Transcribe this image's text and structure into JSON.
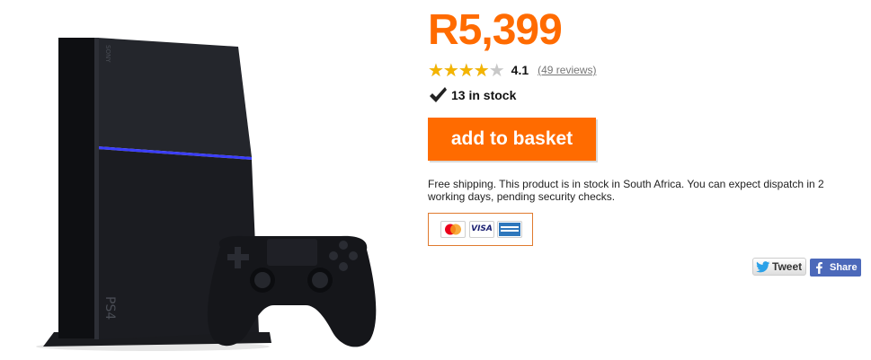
{
  "product": {
    "image_icon": "playstation-4-console-and-controller",
    "price": "R5,399",
    "brand_color": "#ff6b00"
  },
  "rating": {
    "stars_filled_fraction": 0.82,
    "value": "4.1",
    "reviews_link": "(49 reviews)",
    "star_color": "#f4b400"
  },
  "stock": {
    "icon": "checkmark-icon",
    "text": "13 in stock"
  },
  "basket_button": {
    "label": "add to basket"
  },
  "shipping": {
    "text": "Free shipping. This product is in stock in South Africa. You can expect dispatch in 2 working days, pending security checks."
  },
  "payment": {
    "cards": [
      "mastercard-icon",
      "visa-icon",
      "amex-icon"
    ],
    "visa_label": "VISA"
  },
  "social": {
    "tweet_label": "Tweet",
    "share_label": "Share"
  }
}
